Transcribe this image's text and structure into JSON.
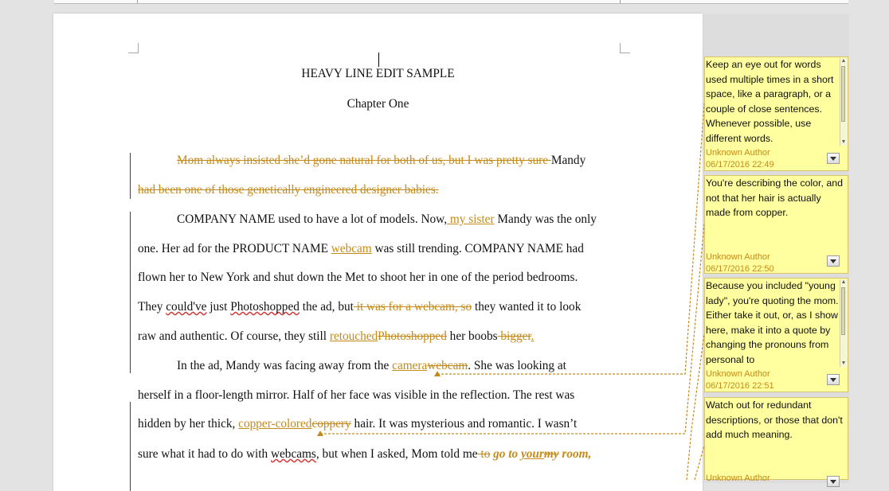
{
  "document": {
    "title": "HEAVY LINE EDIT SAMPLE",
    "chapter": "Chapter One",
    "p1": {
      "l1_del": "Mom always insisted she’d gone natural for both of us, but I was pretty sure ",
      "l1_txt": "Mandy",
      "l1_del2": " ",
      "l2_del": "had been one of those genetically engineered designer babies."
    },
    "p2": {
      "l1_a": "COMPANY NAME used to have a lot of models. Now,",
      "l1_ins": " my sister",
      "l1_b": " Mandy was the only",
      "l2_a": "one. Her ad for the PRODUCT NAME ",
      "l2_ins": "webcam",
      "l2_b": " was still trending. COMPANY NAME had",
      "l3": "flown her to New York and shut down the Met to shoot her in one of the period bedrooms.",
      "l4_a": "They ",
      "l4_sq1": "could've",
      "l4_b": " just ",
      "l4_sq2": "Photoshopped",
      "l4_c": " the ad, but",
      "l4_del": " it was for a webcam, so",
      "l4_d": " they wanted it to look",
      "l5_a": "raw and authentic. Of course, they still ",
      "l5_ins": "retouched",
      "l5_del": "Photoshopped",
      "l5_b": " her boobs",
      "l5_del2": " bigger",
      "l5_c": ". "
    },
    "p3": {
      "l1_a": "In the ad, Mandy was facing away from the ",
      "l1_ins": "camera",
      "l1_del": "webcam",
      "l1_b": ". She was looking at",
      "l2": "herself in a floor-length mirror. Half of her face was visible in the reflection. The rest was",
      "l3_a": "hidden by her thick, ",
      "l3_ins": "copper-colored",
      "l3_del": "coppery",
      "l3_b": " hair. It was mysterious and romantic. I wasn’t",
      "l4_a": "sure what it had to do with ",
      "l4_sq": "webcams",
      "l4_b": ", but when I asked, Mom told me",
      "l4_del": " to",
      "l4_bi1": " go to ",
      "l4_ins": "your",
      "l4_del2": "my",
      "l4_bi2": " room,"
    }
  },
  "comments": [
    {
      "text": "Keep an eye out for words used multiple times in a short space, like a paragraph, or a couple of close sentences. Whenever possible, use different words.",
      "author": "Unknown Author",
      "date": "06/17/2016 22:49"
    },
    {
      "text": "You're describing the color, and not that her hair is actually made from copper.",
      "author": "Unknown Author",
      "date": "06/17/2016 22:50"
    },
    {
      "text": "Because you included \"young lady\", you're quoting the mom. Either take it out, or, as I show here, make it into a quote by changing the pronouns from personal to",
      "author": "Unknown Author",
      "date": "06/17/2016 22:51"
    },
    {
      "text": "Watch out for redundant descriptions, or those that don't add much meaning.",
      "author": "Unknown Author",
      "date": ""
    }
  ],
  "colors": {
    "revision": "#c48a1a",
    "comment_bg": "#ffff9f",
    "spelling": "#d23c3c"
  },
  "icons": {
    "comment_menu": "chevron-down-icon"
  }
}
